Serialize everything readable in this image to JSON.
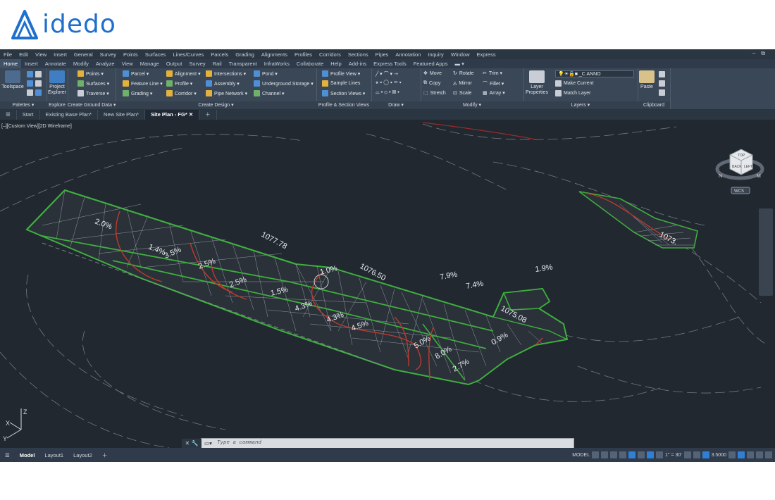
{
  "brand": {
    "name": "idedo",
    "logo_color": "#1f6fcf"
  },
  "menu": [
    "File",
    "Edit",
    "View",
    "Insert",
    "General",
    "Survey",
    "Points",
    "Surfaces",
    "Lines/Curves",
    "Parcels",
    "Grading",
    "Alignments",
    "Profiles",
    "Corridors",
    "Sections",
    "Pipes",
    "Annotation",
    "Inquiry",
    "Window",
    "Express"
  ],
  "ribbon_tabs": [
    "Home",
    "Insert",
    "Annotate",
    "Modify",
    "Analyze",
    "View",
    "Manage",
    "Output",
    "Survey",
    "Rail",
    "Transparent",
    "InfraWorks",
    "Collaborate",
    "Help",
    "Add-ins",
    "Express Tools",
    "Featured Apps"
  ],
  "active_ribbon_tab": "Home",
  "ribbon": {
    "palettes": {
      "title": "Palettes ▾",
      "toolspace": "Toolspace"
    },
    "explore": {
      "title": "Explore",
      "project_explorer": "Project Explorer"
    },
    "ground": {
      "title": "Create Ground Data ▾",
      "points": "Points ▾",
      "surfaces": "Surfaces ▾",
      "traverse": "Traverse ▾"
    },
    "design": {
      "title": "Create Design ▾",
      "parcel": "Parcel ▾",
      "feature_line": "Feature Line ▾",
      "grading": "Grading ▾",
      "alignment": "Alignment ▾",
      "profile": "Profile ▾",
      "corridor": "Corridor ▾",
      "intersections": "Intersections ▾",
      "assembly": "Assembly ▾",
      "pipe_network": "Pipe Network ▾",
      "pond": "Pond ▾",
      "underground_storage": "Underground Storage ▾",
      "channel": "Channel ▾"
    },
    "profile_section": {
      "title": "Profile & Section Views",
      "profile_view": "Profile View ▾",
      "sample_lines": "Sample Lines",
      "section_views": "Section Views ▾"
    },
    "draw": {
      "title": "Draw ▾"
    },
    "modify": {
      "title": "Modify ▾",
      "move": "Move",
      "copy": "Copy",
      "stretch": "Stretch",
      "rotate": "Rotate",
      "mirror": "Mirror",
      "scale": "Scale",
      "trim": "Trim ▾",
      "fillet": "Fillet ▾",
      "array": "Array ▾"
    },
    "layers": {
      "title": "Layers ▾",
      "layer_properties": "Layer Properties",
      "current_layer": "_C ANNO",
      "make_current": "Make Current",
      "match_layer": "Match Layer"
    },
    "clipboard": {
      "title": "Clipboard",
      "paste": "Paste"
    }
  },
  "doc_tabs": [
    "Start",
    "Existing Base Plan*",
    "New Site Plan*",
    "Site Plan - FG*"
  ],
  "active_doc_tab": "Site Plan - FG*",
  "viewport": {
    "label": "[–][Custom View][2D Wireframe]",
    "wcs": "WCS",
    "labels": {
      "slope_20_left": "2.0%",
      "slope_14": "1.4%",
      "slope_35": "3.5%",
      "slope_25_a": "2.5%",
      "slope_25_b": "2.5%",
      "slope_15": "1.5%",
      "slope_43_a": "4.3%",
      "slope_43_b": "4.3%",
      "slope_45": "4.5%",
      "slope_10": "1.0%",
      "slope_50": "5.0%",
      "slope_80": "8.0%",
      "slope_27": "2.7%",
      "slope_79": "7.9%",
      "slope_74": "7.4%",
      "slope_19": "1.9%",
      "slope_09": "0.9%",
      "elev_107778": "1077.78",
      "elev_107650": "1076.50",
      "elev_107508": "1075.08",
      "elev_1073": "1073."
    },
    "viewcube": {
      "top": "TOP",
      "front": "BACK",
      "side": "LEFT",
      "north": "N",
      "mark": "M"
    }
  },
  "command_line": {
    "placeholder": "Type a command",
    "close": "✕",
    "wrench": "🔧"
  },
  "layout_tabs": [
    "Model",
    "Layout1",
    "Layout2"
  ],
  "active_layout": "Model",
  "status": {
    "space": "MODEL",
    "scale": "1\" = 30'",
    "lineweight": "3.5000"
  },
  "colors": {
    "accent": "#2f7fd6",
    "surface_green": "#3fae3f",
    "contour_red": "#c0392b",
    "background": "#212830"
  }
}
